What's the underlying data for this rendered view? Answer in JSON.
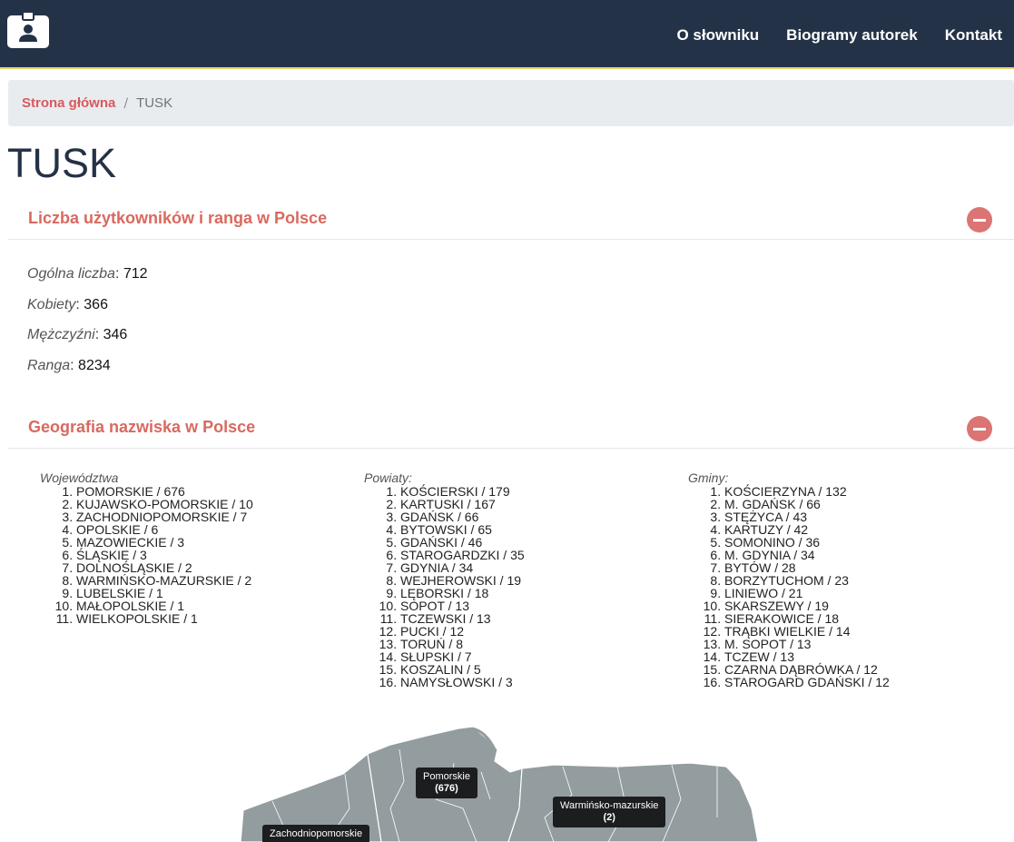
{
  "nav": {
    "links": [
      "O słowniku",
      "Biogramy autorek",
      "Kontakt"
    ]
  },
  "breadcrumb": {
    "home": "Strona główna",
    "separator": "/",
    "current": "TUSK"
  },
  "page_title": "TUSK",
  "section_users": {
    "title": "Liczba użytkowników i ranga w Polsce",
    "stats": [
      {
        "label": "Ogólna liczba",
        "value": "712"
      },
      {
        "label": "Kobiety",
        "value": "366"
      },
      {
        "label": "Mężczyźni",
        "value": "346"
      },
      {
        "label": "Ranga",
        "value": "8234"
      }
    ]
  },
  "section_geo": {
    "title": "Geografia nazwiska w Polsce",
    "voivodeships_label": "Województwa",
    "voivodeships": [
      "POMORSKIE / 676",
      "KUJAWSKO-POMORSKIE / 10",
      "ZACHODNIOPOMORSKIE / 7",
      "OPOLSKIE / 6",
      "MAZOWIECKIE / 3",
      "ŚLĄSKIE / 3",
      "DOLNOŚLĄSKIE / 2",
      "WARMIŃSKO-MAZURSKIE / 2",
      "LUBELSKIE / 1",
      "MAŁOPOLSKIE / 1",
      "WIELKOPOLSKIE / 1"
    ],
    "counties_label": "Powiaty:",
    "counties": [
      "KOŚCIERSKI / 179",
      "KARTUSKI / 167",
      "GDAŃSK / 66",
      "BYTOWSKI / 65",
      "GDAŃSKI / 46",
      "STAROGARDZKI / 35",
      "GDYNIA / 34",
      "WEJHEROWSKI / 19",
      "LĘBORSKI / 18",
      "SOPOT / 13",
      "TCZEWSKI / 13",
      "PUCKI / 12",
      "TORUŃ / 8",
      "SŁUPSKI / 7",
      "KOSZALIN / 5",
      "NAMYSŁOWSKI / 3"
    ],
    "communes_label": "Gminy:",
    "communes": [
      "KOŚCIERZYNA / 132",
      "M. GDAŃSK / 66",
      "STĘŻYCA / 43",
      "KARTUZY / 42",
      "SOMONINO / 36",
      "M. GDYNIA / 34",
      "BYTÓW / 28",
      "BORZYTUCHOM / 23",
      "LINIEWO / 21",
      "SKARSZEWY / 19",
      "SIERAKOWICE / 18",
      "TRĄBKI WIELKIE / 14",
      "M. SOPOT / 13",
      "TCZEW / 13",
      "CZARNA DĄBRÓWKA / 12",
      "STAROGARD GDAŃSKI / 12"
    ]
  },
  "map": {
    "fill_color": "#939c9f",
    "border_color": "#ffffff",
    "labels": [
      {
        "name": "Pomorskie",
        "count": "(676)"
      },
      {
        "name": "Warmińsko-mazurskie",
        "count": "(2)"
      },
      {
        "name": "Zachodniopomorskie",
        "count": ""
      }
    ]
  }
}
